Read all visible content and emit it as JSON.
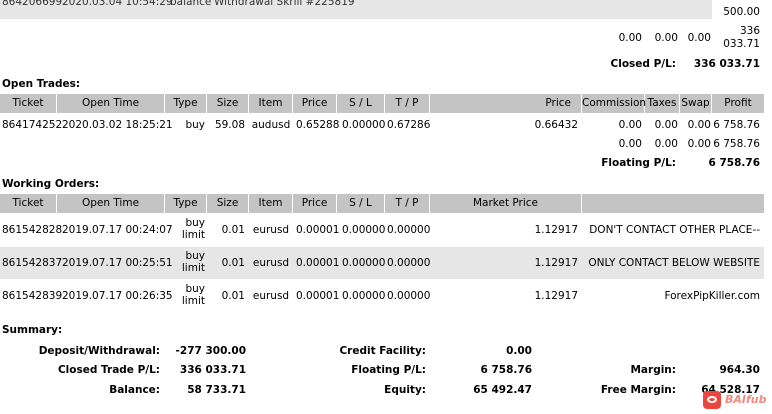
{
  "top_row": {
    "ticket": "864206699",
    "time": "2020.03.04 10:54:29",
    "type": "balance",
    "item": "Withdrawal Skrill #225819",
    "amount": "500.00"
  },
  "closed_totals": {
    "commission": "0.00",
    "taxes": "0.00",
    "swap": "0.00",
    "profit_line1": "336",
    "profit_line2": "033.71",
    "label": "Closed P/L:",
    "value": "336 033.71"
  },
  "open_trades": {
    "title": "Open Trades:",
    "columns": [
      "Ticket",
      "Open Time",
      "Type",
      "Size",
      "Item",
      "Price",
      "S / L",
      "T / P",
      "Price",
      "Commission",
      "Taxes",
      "Swap",
      "Profit"
    ],
    "rows": [
      {
        "ticket": "864174252",
        "time": "2020.03.02 18:25:21",
        "type": "buy",
        "size": "59.08",
        "item": "audusd",
        "price": "0.65288",
        "sl": "0.00000",
        "tp": "0.67286",
        "price2": "0.66432",
        "commission": "0.00",
        "taxes": "0.00",
        "swap": "0.00",
        "profit": "6 758.76"
      }
    ],
    "totals": {
      "commission": "0.00",
      "taxes": "0.00",
      "swap": "0.00",
      "profit": "6 758.76"
    },
    "floating_label": "Floating P/L:",
    "floating_value": "6 758.76"
  },
  "working_orders": {
    "title": "Working Orders:",
    "columns": [
      "Ticket",
      "Open Time",
      "Type",
      "Size",
      "Item",
      "Price",
      "S / L",
      "T / P",
      "Market Price"
    ],
    "rows": [
      {
        "ticket": "861542828",
        "time": "2019.07.17 00:24:07",
        "type1": "buy",
        "type2": "limit",
        "size": "0.01",
        "item": "eurusd",
        "price": "0.00001",
        "sl": "0.00000",
        "tp": "0.00000",
        "market": "1.12917",
        "comment": "DON'T CONTACT OTHER PLACE--"
      },
      {
        "ticket": "861542837",
        "time": "2019.07.17 00:25:51",
        "type1": "buy",
        "type2": "limit",
        "size": "0.01",
        "item": "eurusd",
        "price": "0.00001",
        "sl": "0.00000",
        "tp": "0.00000",
        "market": "1.12917",
        "comment": "ONLY CONTACT BELOW WEBSITE"
      },
      {
        "ticket": "861542839",
        "time": "2019.07.17 00:26:35",
        "type1": "buy",
        "type2": "limit",
        "size": "0.01",
        "item": "eurusd",
        "price": "0.00001",
        "sl": "0.00000",
        "tp": "0.00000",
        "market": "1.12917",
        "comment": "ForexPipKiller.com"
      }
    ]
  },
  "summary": {
    "title": "Summary:",
    "deposit_label": "Deposit/Withdrawal:",
    "deposit_value": "-277 300.00",
    "closed_label": "Closed Trade P/L:",
    "closed_value": "336 033.71",
    "balance_label": "Balance:",
    "balance_value": "58 733.71",
    "credit_label": "Credit Facility:",
    "credit_value": "0.00",
    "floating_label": "Floating P/L:",
    "floating_value": "6 758.76",
    "equity_label": "Equity:",
    "equity_value": "65 492.47",
    "margin_label": "Margin:",
    "margin_value": "964.30",
    "free_margin_label": "Free Margin:",
    "free_margin_value": "64 528.17"
  },
  "watermark": {
    "text": "BAIfub",
    "icon": "chat-bubble-icon",
    "color": "#e8463f"
  }
}
